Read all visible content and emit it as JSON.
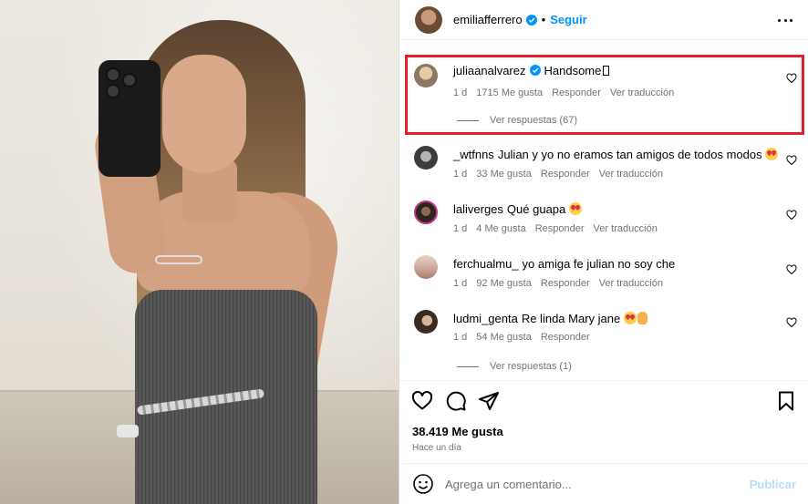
{
  "post": {
    "author": "emiliafferrero",
    "separator": "•",
    "follow_label": "Seguir"
  },
  "comments": [
    {
      "username": "juliaanalvarez",
      "verified": true,
      "text": "Handsome",
      "age": "1 d",
      "likes": "1715 Me gusta",
      "reply": "Responder",
      "translate": "Ver traducción",
      "view_replies": "Ver respuestas (67)"
    },
    {
      "username": "_wtfnns",
      "text": "Julian y yo no eramos tan amigos de todos modos",
      "age": "1 d",
      "likes": "33 Me gusta",
      "reply": "Responder",
      "translate": "Ver traducción"
    },
    {
      "username": "laliverges",
      "text": "Qué guapa",
      "age": "1 d",
      "likes": "4 Me gusta",
      "reply": "Responder",
      "translate": "Ver traducción"
    },
    {
      "username": "ferchualmu_",
      "text": "yo amiga fe julian no soy che",
      "age": "1 d",
      "likes": "92 Me gusta",
      "reply": "Responder",
      "translate": "Ver traducción"
    },
    {
      "username": "ludmi_genta",
      "text": "Re linda Mary jane",
      "age": "1 d",
      "likes": "54 Me gusta",
      "reply": "Responder",
      "view_replies": "Ver respuestas (1)"
    }
  ],
  "footer": {
    "likes_count": "38.419 Me gusta",
    "posted": "Hace un día",
    "comment_placeholder": "Agrega un comentario...",
    "publish_label": "Publicar"
  },
  "colors": {
    "accent_blue": "#0095f6",
    "highlight_red": "#e3212d",
    "muted_text": "#737373"
  }
}
